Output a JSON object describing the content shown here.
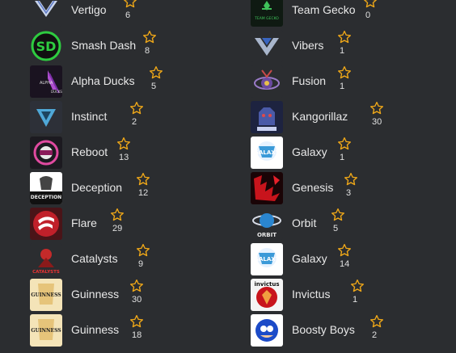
{
  "colors": {
    "background": "#2b2d30",
    "star": "#f0a818",
    "text": "#e8e8e8"
  },
  "left": [
    {
      "name": "Vertigo",
      "count": "6",
      "icon": "vertigo-logo"
    },
    {
      "name": "Smash Dash",
      "count": "8",
      "icon": "smash-dash-logo"
    },
    {
      "name": "Alpha Ducks",
      "count": "5",
      "icon": "alpha-ducks-logo",
      "logo_text": "ALPHA DUCKS"
    },
    {
      "name": "Instinct",
      "count": "2",
      "icon": "instinct-logo"
    },
    {
      "name": "Reboot",
      "count": "13",
      "icon": "reboot-logo"
    },
    {
      "name": "Deception",
      "count": "12",
      "icon": "deception-logo",
      "logo_text": "DECEPTION"
    },
    {
      "name": "Flare",
      "count": "29",
      "icon": "flare-logo"
    },
    {
      "name": "Catalysts",
      "count": "9",
      "icon": "catalysts-logo",
      "logo_text": "CATALYSTS"
    },
    {
      "name": "Guinness",
      "count": "30",
      "icon": "guinness-logo",
      "logo_text": "GUINNESS"
    },
    {
      "name": "Guinness",
      "count": "18",
      "icon": "guinness-logo",
      "logo_text": "GUINNESS"
    }
  ],
  "right": [
    {
      "name": "Team Gecko",
      "count": "0",
      "icon": "team-gecko-logo",
      "logo_text": "TEAM GECKO"
    },
    {
      "name": "Vibers",
      "count": "1",
      "icon": "vibers-logo"
    },
    {
      "name": "Fusion",
      "count": "1",
      "icon": "fusion-logo"
    },
    {
      "name": "Kangorillaz",
      "count": "30",
      "icon": "kangorillaz-logo"
    },
    {
      "name": "Galaxy",
      "count": "1",
      "icon": "galaxy-logo",
      "logo_text": "GALAXY"
    },
    {
      "name": "Genesis",
      "count": "3",
      "icon": "genesis-logo"
    },
    {
      "name": "Orbit",
      "count": "5",
      "icon": "orbit-logo",
      "logo_text": "ORBIT"
    },
    {
      "name": "Galaxy",
      "count": "14",
      "icon": "galaxy-logo",
      "logo_text": "GALAXY"
    },
    {
      "name": "Invictus",
      "count": "1",
      "icon": "invictus-logo",
      "logo_text": "invictus"
    },
    {
      "name": "Boosty Boys",
      "count": "2",
      "icon": "boosty-boys-logo"
    }
  ]
}
